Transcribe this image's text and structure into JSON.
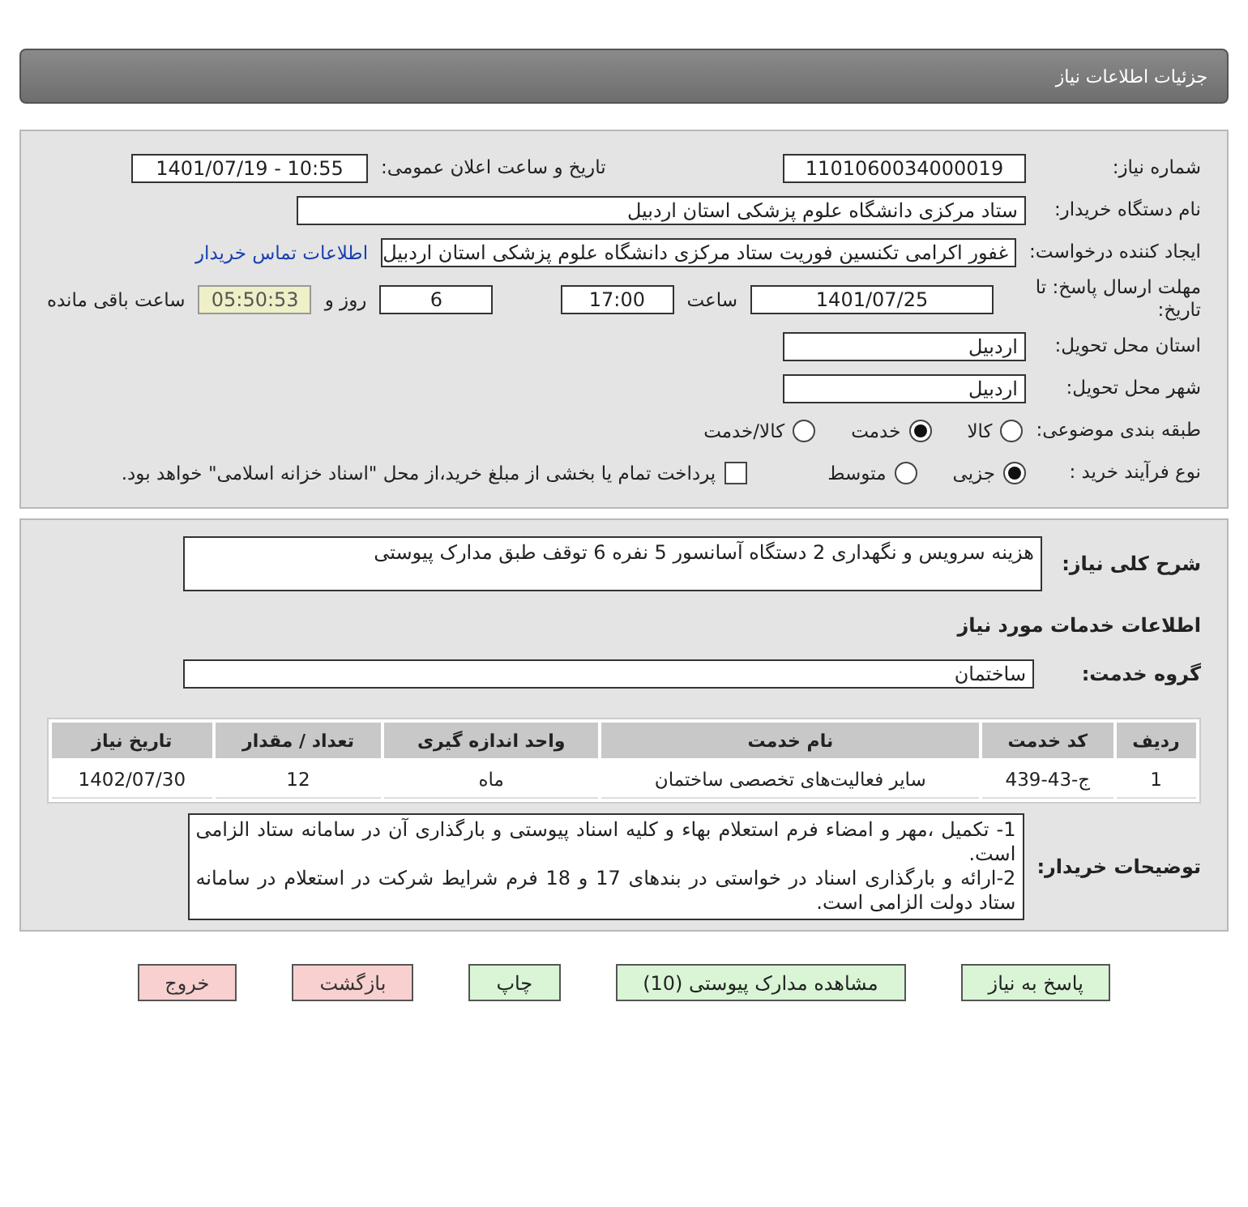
{
  "header": {
    "title": "جزئیات اطلاعات نیاز"
  },
  "need_number": {
    "label": "شماره نیاز:",
    "value": "1101060034000019"
  },
  "announce": {
    "label": "تاریخ و ساعت اعلان عمومی:",
    "value": "1401/07/19 - 10:55"
  },
  "buyer": {
    "label": "نام دستگاه خریدار:",
    "value": "ستاد مرکزی دانشگاه علوم پزشکی استان اردبیل"
  },
  "creator": {
    "label": "ایجاد کننده درخواست:",
    "value": "غفور اکرامی تکنسین فوریت ستاد مرکزی دانشگاه علوم پزشکی استان اردبیل",
    "link": "اطلاعات تماس خریدار"
  },
  "deadline": {
    "label": "مهلت ارسال پاسخ: تا تاریخ:",
    "date": "1401/07/25",
    "time_label": "ساعت",
    "time": "17:00",
    "days": "6",
    "days_label": "روز و",
    "remaining": "05:50:53",
    "remaining_label": "ساعت باقی مانده"
  },
  "province": {
    "label": "استان محل تحویل:",
    "value": "اردبیل"
  },
  "city": {
    "label": "شهر محل تحویل:",
    "value": "اردبیل"
  },
  "category": {
    "label": "طبقه بندی موضوعی:",
    "options": [
      {
        "label": "کالا",
        "selected": false
      },
      {
        "label": "خدمت",
        "selected": true
      },
      {
        "label": "کالا/خدمت",
        "selected": false
      }
    ]
  },
  "process": {
    "label": "نوع فرآیند خرید :",
    "options": [
      {
        "label": "جزیی",
        "selected": true
      },
      {
        "label": "متوسط",
        "selected": false
      }
    ],
    "payment": {
      "label": "پرداخت تمام یا بخشی از مبلغ خرید،از محل \"اسناد خزانه اسلامی\" خواهد بود.",
      "checked": false
    }
  },
  "description": {
    "label": "شرح کلی نیاز:",
    "value": "هزینه سرویس و نگهداری 2 دستگاه آسانسور 5 نفره 6 توقف طبق مدارک پیوستی"
  },
  "services_title": "اطلاعات خدمات مورد نیاز",
  "service_group": {
    "label": "گروه خدمت:",
    "value": "ساختمان"
  },
  "table": {
    "columns": [
      "ردیف",
      "کد خدمت",
      "نام خدمت",
      "واحد اندازه گیری",
      "تعداد / مقدار",
      "تاریخ نیاز"
    ],
    "rows": [
      [
        "1",
        "ج-43-439",
        "سایر فعالیت‌های تخصصی ساختمان",
        "ماه",
        "12",
        "1402/07/30"
      ]
    ]
  },
  "buyer_notes": {
    "label": "توضیحات خریدار:",
    "paragraphs": [
      "1- تکمیل ،مهر و امضاء فرم استعلام بهاء و کلیه اسناد پیوستی و بارگذاری آن در سامانه ستاد الزامی است.",
      "2-ارائه و بارگذاری اسناد در خواستی در بندهای 17 و 18 فرم شرایط شرکت در استعلام در سامانه ستاد دولت الزامی است."
    ]
  },
  "buttons": [
    {
      "label": "پاسخ به نیاز",
      "kind": "primary"
    },
    {
      "label": "مشاهده مدارک پیوستی (10)",
      "kind": "primary"
    },
    {
      "label": "چاپ",
      "kind": "primary"
    },
    {
      "label": "بازگشت",
      "kind": "danger"
    },
    {
      "label": "خروج",
      "kind": "danger"
    }
  ]
}
